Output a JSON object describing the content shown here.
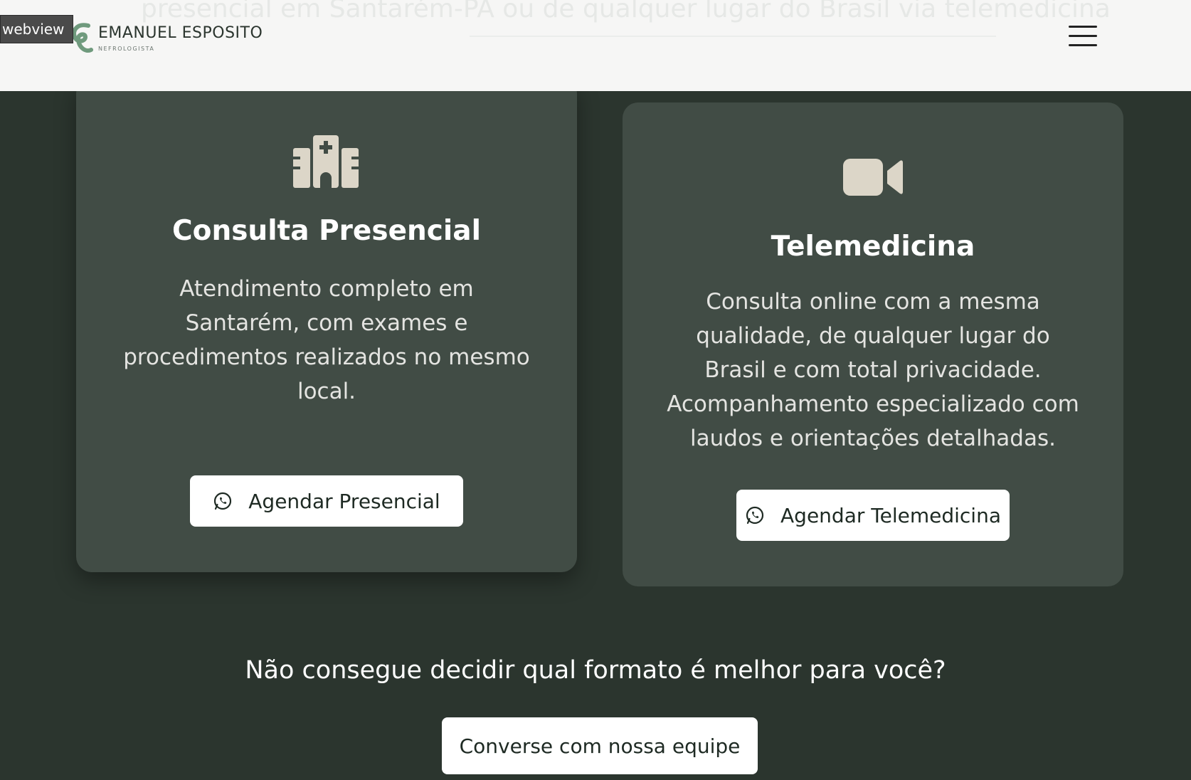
{
  "header": {
    "ghost_text": "presencial em Santarém-PA ou de qualquer lugar do Brasil via telemedicina",
    "webview_label": "webview",
    "logo_name": "EMANUEL ESPOSITO",
    "logo_subtitle": "NEFROLOGISTA",
    "menu_icon": "hamburger-menu-icon"
  },
  "cards": [
    {
      "icon": "hospital-icon",
      "title": "Consulta Presencial",
      "description": "Atendimento completo em Santarém, com exames e procedimentos realizados no mesmo local.",
      "button_icon": "whatsapp-icon",
      "button_label": "Agendar Presencial"
    },
    {
      "icon": "video-camera-icon",
      "title": "Telemedicina",
      "description": "Consulta online com a mesma qualidade, de qualquer lugar do Brasil e com total privacidade. Acompanhamento especializado com laudos e orientações detalhadas.",
      "button_icon": "whatsapp-icon",
      "button_label": "Agendar Telemedicina"
    }
  ],
  "cta": {
    "question": "Não consegue decidir qual formato é melhor para você?",
    "button_label": "Converse com nossa equipe"
  },
  "colors": {
    "background": "#2b352e",
    "card": "#414c45",
    "icon": "#dcd6c8",
    "header": "#f6f6f5",
    "logo_green": "#6f9a7d"
  }
}
